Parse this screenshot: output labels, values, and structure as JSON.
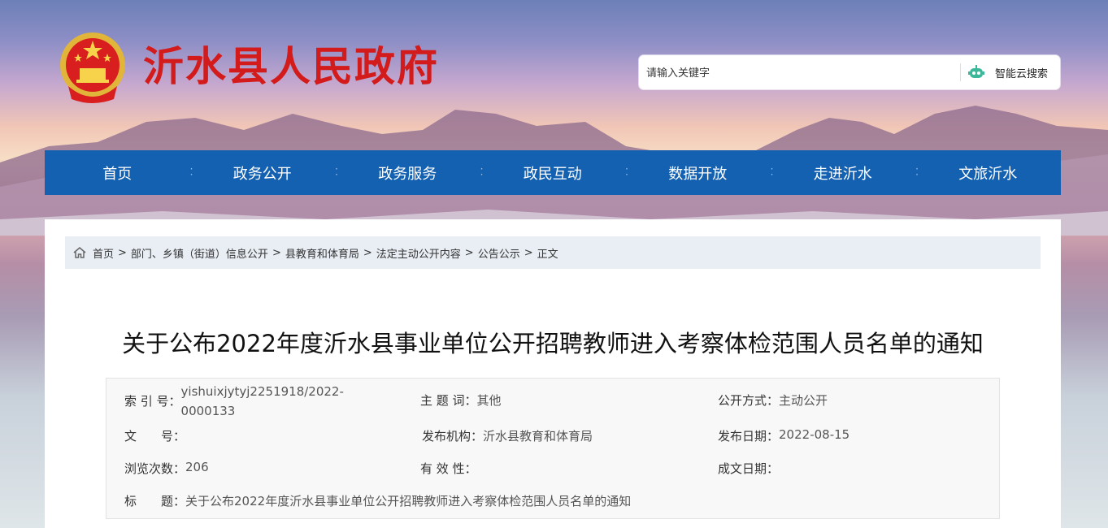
{
  "site": {
    "title": "沂水县人民政府"
  },
  "search": {
    "placeholder": "请输入关键字",
    "button_label": "智能云搜索"
  },
  "nav": {
    "items": [
      "首页",
      "政务公开",
      "政务服务",
      "政民互动",
      "数据开放",
      "走进沂水",
      "文旅沂水"
    ]
  },
  "breadcrumb": {
    "items": [
      "首页",
      "部门、乡镇（街道）信息公开",
      "县教育和体育局",
      "法定主动公开内容",
      "公告公示",
      "正文"
    ],
    "separator": ">"
  },
  "article": {
    "title": "关于公布2022年度沂水县事业单位公开招聘教师进入考察体检范围人员名单的通知",
    "meta": {
      "index_label": "索 引 号：",
      "index_value": "yishuixjytyj2251918/2022-0000133",
      "subject_label": "主 题 词：",
      "subject_value": "其他",
      "method_label": "公开方式：",
      "method_value": "主动公开",
      "docno_label": "文　　号：",
      "docno_value": "",
      "publisher_label": "发布机构：",
      "publisher_value": "沂水县教育和体育局",
      "date_label": "发布日期：",
      "date_value": "2022-08-15",
      "views_label": "浏览次数：",
      "views_value": "206",
      "validity_label": "有 效 性：",
      "validity_value": "",
      "written_label": "成文日期：",
      "written_value": "",
      "title_label": "标　　题：",
      "title_value": "关于公布2022年度沂水县事业单位公开招聘教师进入考察体检范围人员名单的通知"
    }
  },
  "colors": {
    "nav_bg": "#1561b1",
    "title_red": "#d31b1b",
    "breadcrumb_bg": "#e9eef5"
  }
}
